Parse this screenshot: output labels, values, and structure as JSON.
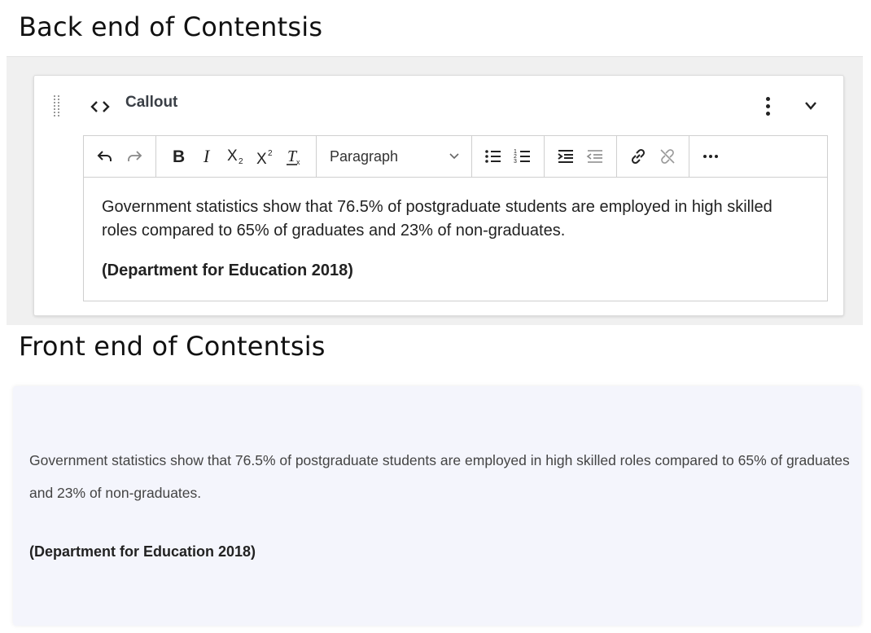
{
  "back_heading": "Back end of Contentsis",
  "front_heading": "Front end of Contentsis",
  "block": {
    "title": "Callout",
    "icons": {
      "drag": "drag-handle-icon",
      "type": "code-brackets-icon",
      "more": "more-vertical-icon",
      "collapse": "chevron-down-icon"
    }
  },
  "toolbar": {
    "buttons": [
      "undo",
      "redo",
      "bold",
      "italic",
      "subscript",
      "superscript",
      "clear-formatting",
      "bulleted-list",
      "numbered-list",
      "indent",
      "outdent",
      "link",
      "unlink",
      "more-horizontal"
    ],
    "format_select": "Paragraph"
  },
  "editor": {
    "body": "Government statistics show that 76.5% of postgraduate students are employed in high skilled roles compared to 65% of graduates and 23% of non-graduates.",
    "citation": "(Department for Education 2018)"
  },
  "front": {
    "body": "Government statistics show that 76.5% of postgraduate students are employed in high skilled roles compared to 65% of graduates and 23% of non-graduates.",
    "citation": "(Department for Education 2018)"
  },
  "colors": {
    "front_bg": "#f4f5fc",
    "panel_bg": "#f0f0f0"
  }
}
